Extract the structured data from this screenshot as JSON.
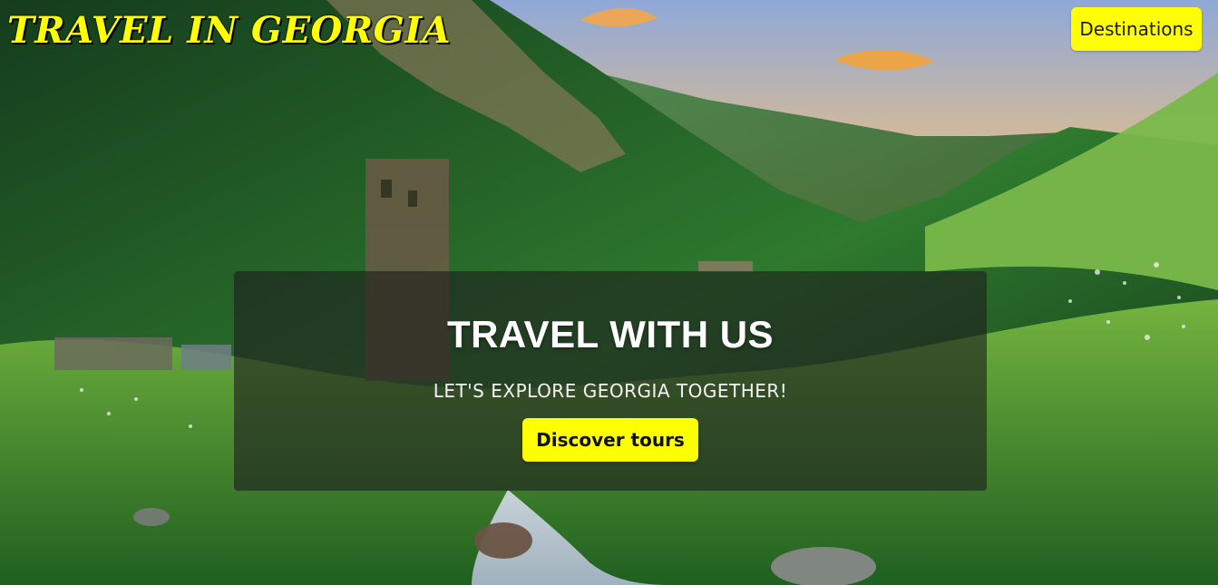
{
  "header": {
    "brand_text": "TRAVEL IN GEORGIA",
    "nav_destinations": "Destinations"
  },
  "hero": {
    "title": "TRAVEL WITH US",
    "subtitle": "LET'S EXPLORE GEORGIA TOGETHER!",
    "cta_label": "Discover tours"
  },
  "theme": {
    "accent": "#ffff00",
    "overlay": "#1e1e1e"
  }
}
